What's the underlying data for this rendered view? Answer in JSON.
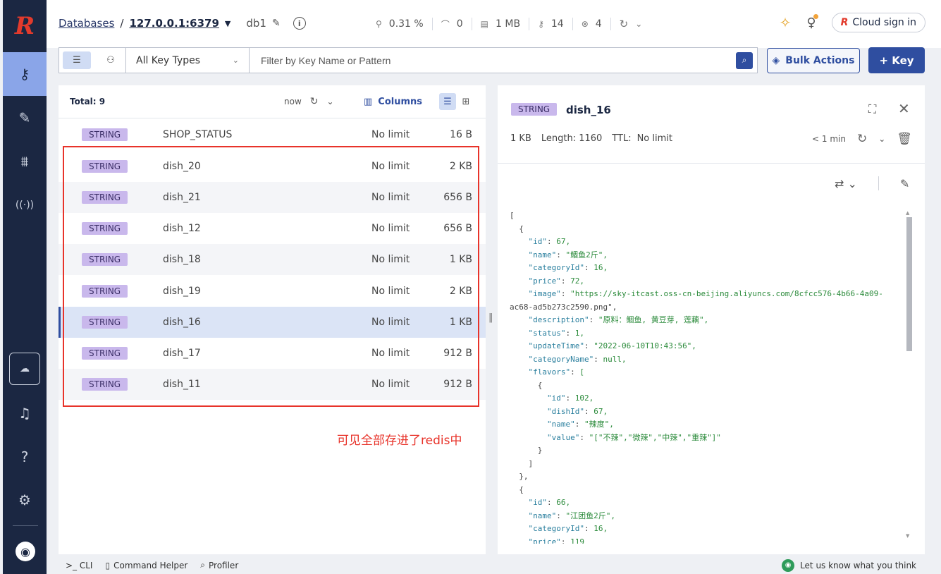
{
  "topbar": {
    "databases": "Databases",
    "host": "127.0.0.1:6379",
    "db": "db1",
    "stats": [
      {
        "icon": "cpu-icon",
        "glyph": "⚲",
        "value": "0.31 %"
      },
      {
        "icon": "ops-icon",
        "glyph": "⌒",
        "value": "0"
      },
      {
        "icon": "memory-icon",
        "glyph": "▤",
        "value": "1 MB"
      },
      {
        "icon": "keys-icon",
        "glyph": "⚷",
        "value": "14"
      },
      {
        "icon": "clients-icon",
        "glyph": "⊗",
        "value": "4"
      }
    ],
    "cloud_sign_in": "Cloud sign in"
  },
  "filter": {
    "key_type": "All Key Types",
    "placeholder": "Filter by Key Name or Pattern",
    "bulk_actions": "Bulk Actions",
    "add_key": "+ Key"
  },
  "list": {
    "total": "Total: 9",
    "refresh_label": "now",
    "columns_label": "Columns",
    "rows": [
      {
        "type": "STRING",
        "name": "SHOP_STATUS",
        "ttl": "No limit",
        "size": "16 B"
      },
      {
        "type": "STRING",
        "name": "dish_20",
        "ttl": "No limit",
        "size": "2 KB"
      },
      {
        "type": "STRING",
        "name": "dish_21",
        "ttl": "No limit",
        "size": "656 B"
      },
      {
        "type": "STRING",
        "name": "dish_12",
        "ttl": "No limit",
        "size": "656 B"
      },
      {
        "type": "STRING",
        "name": "dish_18",
        "ttl": "No limit",
        "size": "1 KB"
      },
      {
        "type": "STRING",
        "name": "dish_19",
        "ttl": "No limit",
        "size": "2 KB"
      },
      {
        "type": "STRING",
        "name": "dish_16",
        "ttl": "No limit",
        "size": "1 KB"
      },
      {
        "type": "STRING",
        "name": "dish_17",
        "ttl": "No limit",
        "size": "912 B"
      },
      {
        "type": "STRING",
        "name": "dish_11",
        "ttl": "No limit",
        "size": "912 B"
      }
    ],
    "annotation": "可见全部存进了redis中"
  },
  "detail": {
    "type": "STRING",
    "name": "dish_16",
    "size": "1 KB",
    "length": "Length: 1160",
    "ttl_label": "TTL:",
    "ttl_value": "No limit",
    "updated": "< 1 min",
    "json_lines": [
      "[",
      "  {",
      "    \"id\": 67,",
      "    \"name\": \"鲴鱼2斤\",",
      "    \"categoryId\": 16,",
      "    \"price\": 72,",
      "    \"image\": \"https://sky-itcast.oss-cn-beijing.aliyuncs.com/8cfcc576-4b66-4a09-",
      "ac68-ad5b273c2590.png\",",
      "    \"description\": \"原料：鲴鱼, 黄豆芽, 莲藕\",",
      "    \"status\": 1,",
      "    \"updateTime\": \"2022-06-10T10:43:56\",",
      "    \"categoryName\": null,",
      "    \"flavors\": [",
      "      {",
      "        \"id\": 102,",
      "        \"dishId\": 67,",
      "        \"name\": \"辣度\",",
      "        \"value\": \"[\"不辣\",\"微辣\",\"中辣\",\"重辣\"]\"",
      "      }",
      "    ]",
      "  },",
      "  {",
      "    \"id\": 66,",
      "    \"name\": \"江团鱼2斤\",",
      "    \"categoryId\": 16,",
      "    \"price\": 119"
    ]
  },
  "bottom": {
    "cli": ">_ CLI",
    "command_helper": "Command Helper",
    "profiler": "Profiler",
    "feedback": "Let us know what you think"
  },
  "colors": {
    "accent": "#2f4ea0",
    "sidebar": "#1b2742",
    "badge": "#c9b8ec",
    "annotation": "#e8332a"
  }
}
